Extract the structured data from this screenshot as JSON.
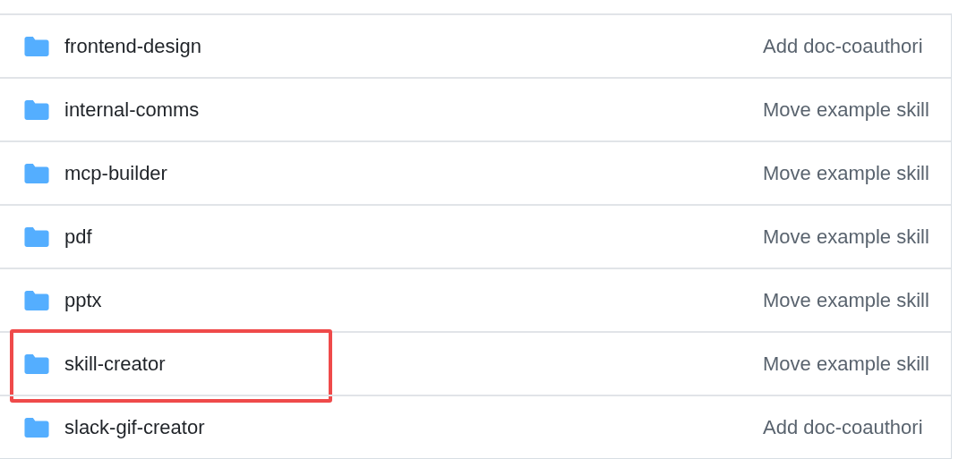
{
  "rows": [
    {
      "name": "frontend-design",
      "message": "Add doc-coauthori",
      "highlighted": false
    },
    {
      "name": "internal-comms",
      "message": "Move example skill",
      "highlighted": false
    },
    {
      "name": "mcp-builder",
      "message": "Move example skill",
      "highlighted": false
    },
    {
      "name": "pdf",
      "message": "Move example skill",
      "highlighted": false
    },
    {
      "name": "pptx",
      "message": "Move example skill",
      "highlighted": false
    },
    {
      "name": "skill-creator",
      "message": "Move example skill",
      "highlighted": true
    },
    {
      "name": "slack-gif-creator",
      "message": "Add doc-coauthori",
      "highlighted": false
    }
  ]
}
